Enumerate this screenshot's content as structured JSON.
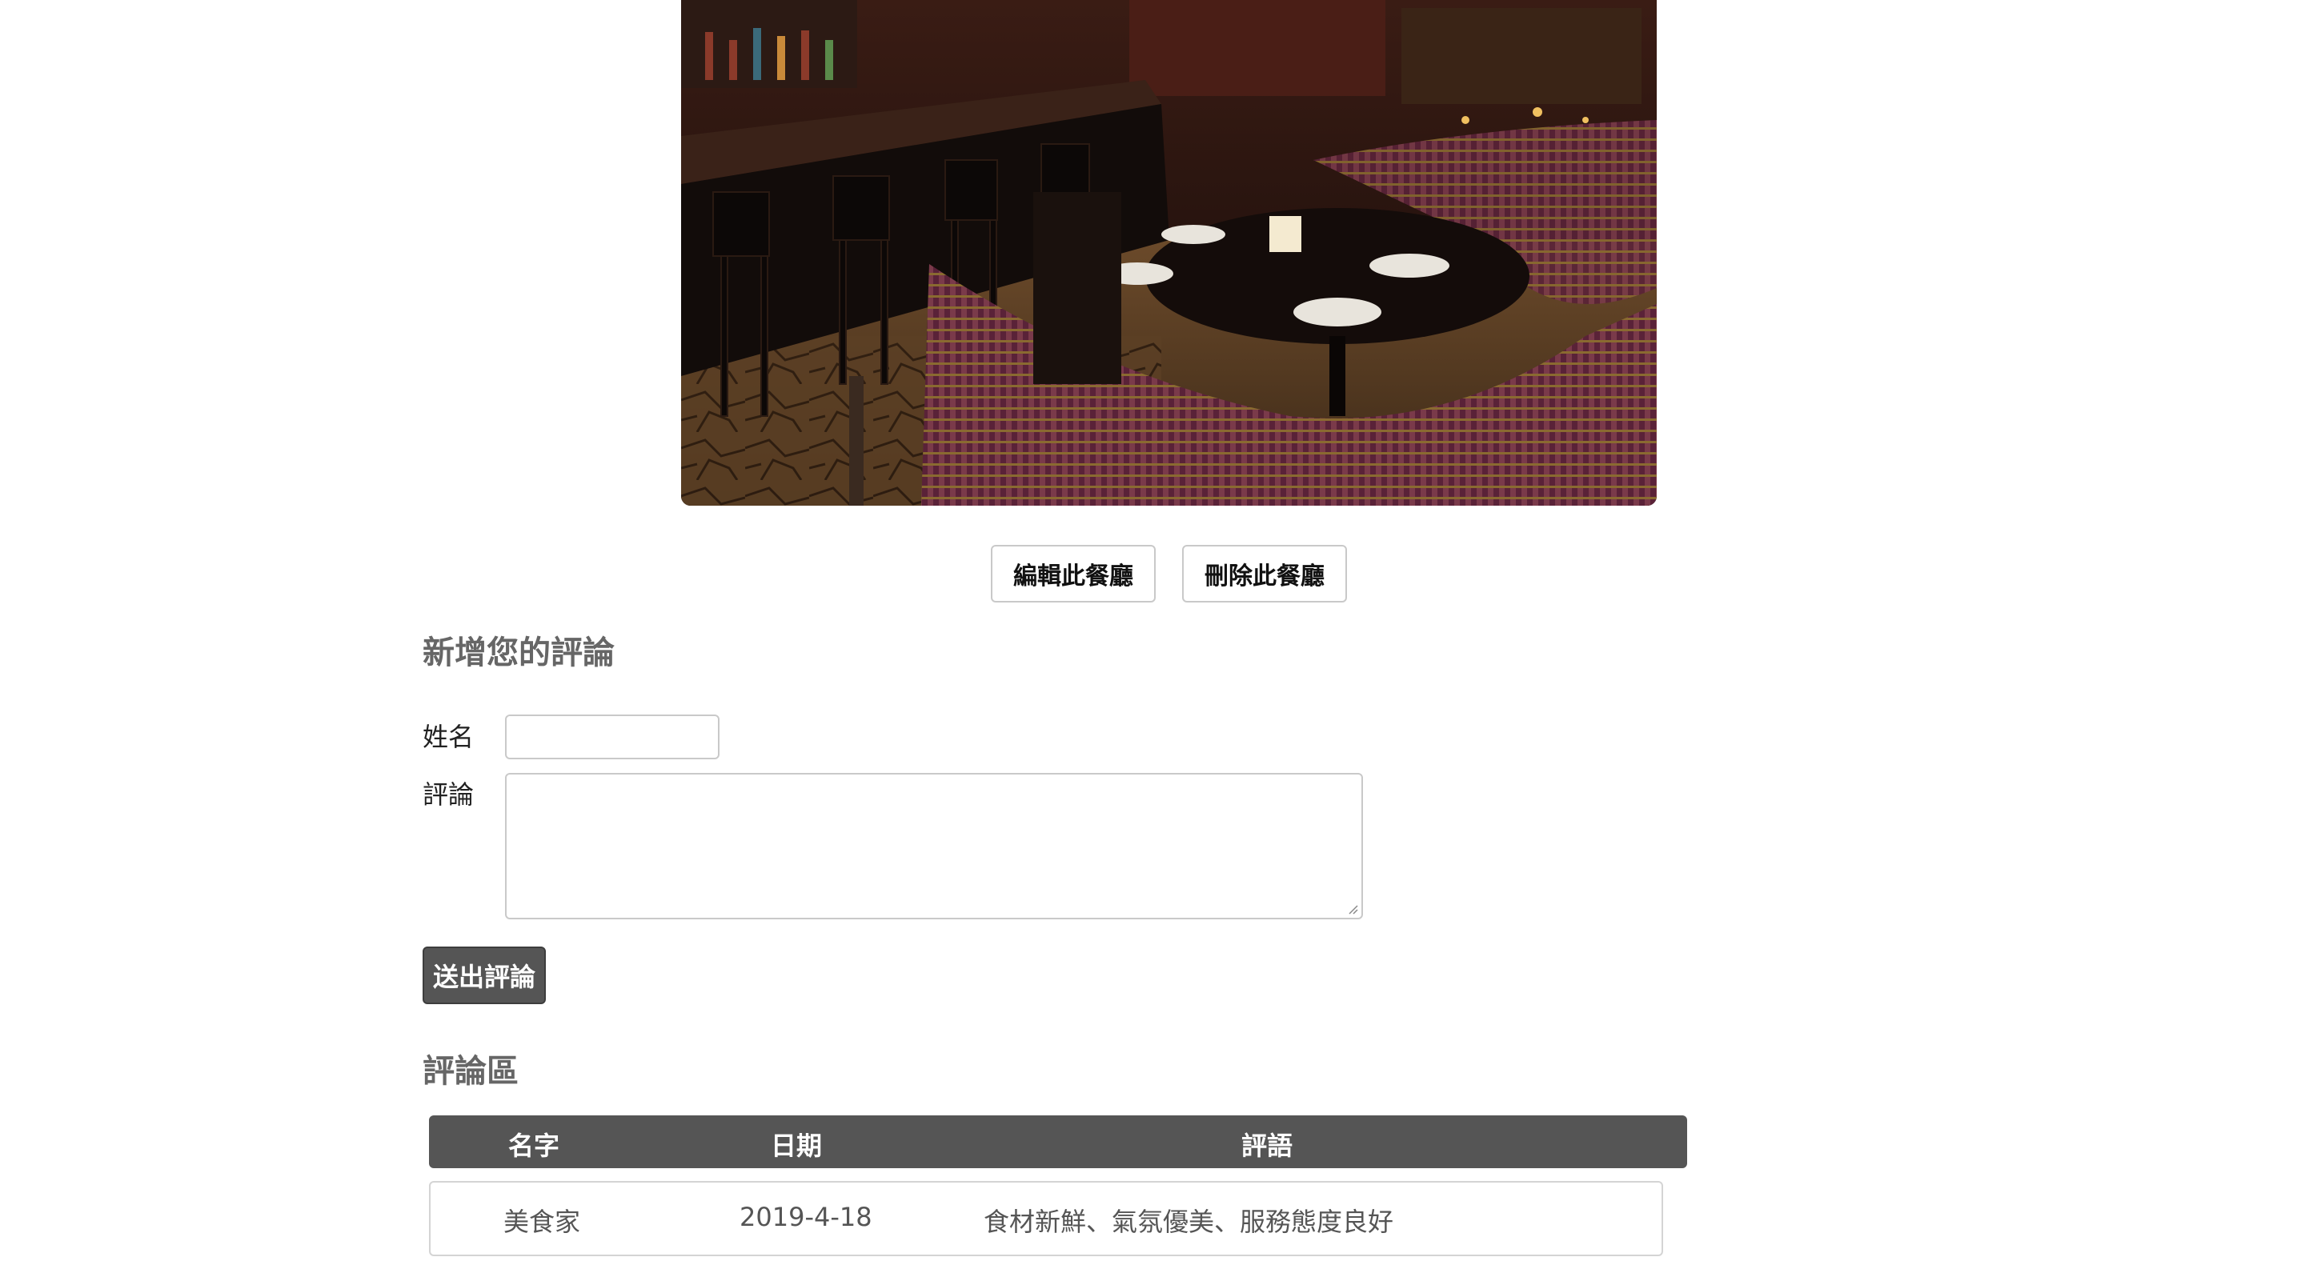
{
  "restaurant": {
    "photo_description_icon": "restaurant-photo"
  },
  "actions": {
    "edit_label": "編輯此餐廳",
    "delete_label": "刪除此餐廳"
  },
  "review_form": {
    "title": "新增您的評論",
    "name_label": "姓名",
    "name_value": "",
    "comment_label": "評論",
    "comment_value": "",
    "submit_label": "送出評論"
  },
  "reviews": {
    "title": "評論區",
    "columns": [
      "名字",
      "日期",
      "評語"
    ],
    "rows": [
      {
        "name": "美食家",
        "date": "2019-4-18",
        "comment": "食材新鮮、氣氛優美、服務態度良好"
      }
    ]
  },
  "colors": {
    "header_bg": "#555555",
    "submit_bg": "#555555",
    "title_gray": "#666666"
  }
}
